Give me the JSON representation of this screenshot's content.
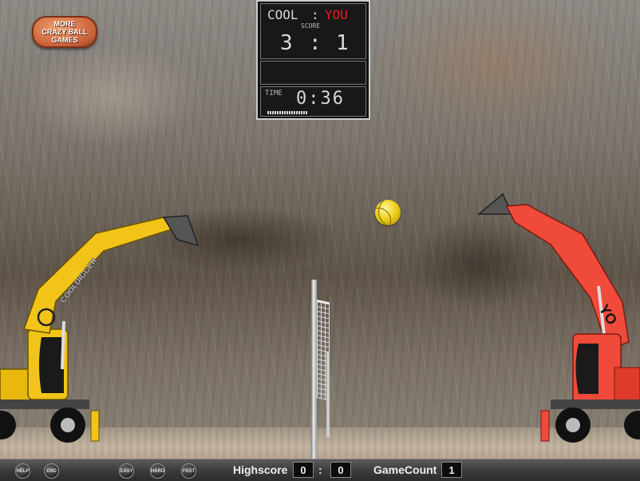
{
  "promo": {
    "line1": "MORE",
    "line2": "CRAZY BALL",
    "line3": "GAMES"
  },
  "scoreboard": {
    "player_left": "COOL",
    "separator": ":",
    "player_right": "YOU",
    "score_label": "SCORE",
    "score_left": "3",
    "score_sep": ":",
    "score_right": "1",
    "time_label": "TIME",
    "time_value": "0:36"
  },
  "diggers": {
    "left": {
      "label": "COOLDIGGER",
      "color": "#f2c41a"
    },
    "right": {
      "label": "YO",
      "color": "#f04a3a"
    }
  },
  "bottom_bar": {
    "buttons": {
      "help": "HELP",
      "end": "END",
      "easy": "EASY",
      "hard": "HARD",
      "fast": "FAST"
    },
    "highscore_label": "Highscore",
    "highscore_left": "0",
    "highscore_sep": ":",
    "highscore_right": "0",
    "gamecount_label": "GameCount",
    "gamecount_value": "1"
  }
}
